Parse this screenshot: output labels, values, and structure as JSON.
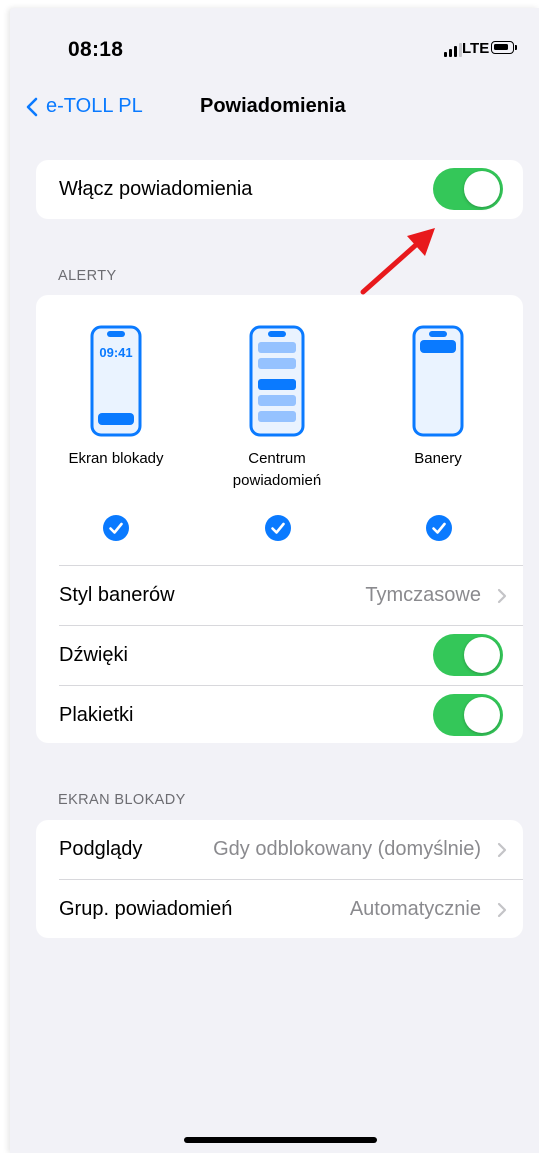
{
  "status_bar": {
    "time": "08:18",
    "network": "LTE"
  },
  "nav": {
    "back_label": "e-TOLL PL",
    "title": "Powiadomienia"
  },
  "enable": {
    "label": "Włącz powiadomienia",
    "on": true
  },
  "alerts": {
    "header": "ALERTY",
    "options": [
      {
        "label": "Ekran blokady",
        "preview_time": "09:41",
        "checked": true
      },
      {
        "label_line1": "Centrum",
        "label_line2": "powiadomień",
        "checked": true
      },
      {
        "label": "Banery",
        "checked": true
      }
    ],
    "banner_style": {
      "label": "Styl banerów",
      "value": "Tymczasowe"
    },
    "sounds": {
      "label": "Dźwięki",
      "on": true
    },
    "badges": {
      "label": "Plakietki",
      "on": true
    }
  },
  "lock_screen": {
    "header": "EKRAN BLOKADY",
    "previews": {
      "label": "Podglądy",
      "value": "Gdy odblokowany (domyślnie)"
    },
    "grouping": {
      "label": "Grup. powiadomień",
      "value": "Automatycznie"
    }
  },
  "colors": {
    "accent": "#0a7aff",
    "toggle_on": "#34c759",
    "arrow": "#e8191c",
    "background": "#f2f2f7"
  }
}
